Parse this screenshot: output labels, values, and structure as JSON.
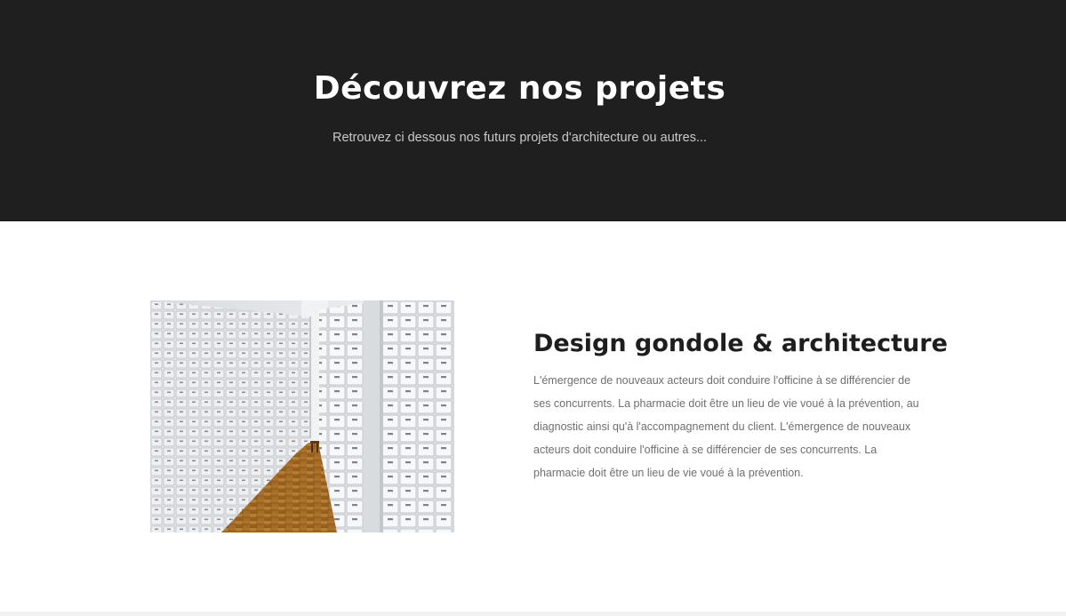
{
  "hero": {
    "title": "Découvrez nos projets",
    "subtitle": "Retrouvez ci dessous nos futurs projets d'architecture ou autres..."
  },
  "project": {
    "title": "Design gondole & architecture",
    "description": "L'émergence de nouveaux acteurs doit conduire l'officine à se différencier de ses concurrents. La pharmacie doit être un lieu de vie voué à la prévention, au diagnostic ainsi qu'à l'accompagnement du client. L'émergence de nouveaux acteurs doit conduire l'officine à se différencier de ses concurrents. La pharmacie doit être un lieu de vie voué à la prévention."
  },
  "colors": {
    "hero_background": "#1f1f1f",
    "hero_text": "#ffffff",
    "body_text": "#6f6f6f",
    "heading_text": "#1e1e1e"
  }
}
